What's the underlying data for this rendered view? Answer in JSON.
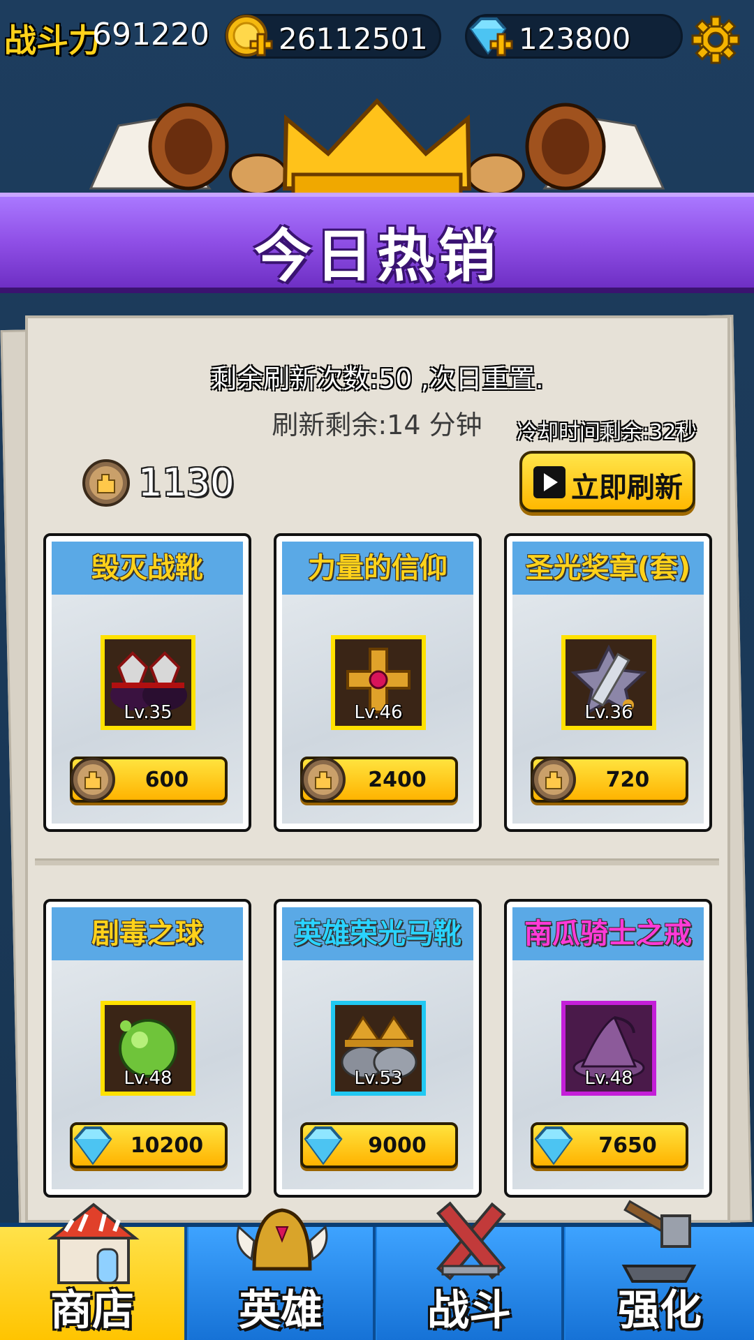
{
  "header": {
    "power_label": "战斗力",
    "power_value": "691220",
    "gold_value": "26112501",
    "gem_value": "123800"
  },
  "banner": {
    "title": "今日热销"
  },
  "shop": {
    "refresh_count_text": "剩余刷新次数:50 ,次日重置.",
    "refresh_remaining_text": "刷新剩余:14 分钟",
    "cooldown_text": "冷却时间剩余:32秒",
    "token_count": "1130",
    "refresh_button_label": "立即刷新",
    "items": [
      {
        "name": "毁灭战靴",
        "level": "Lv.35",
        "price": "600",
        "currency": "token",
        "name_color": "#ffd21a",
        "frame_color": "#ffe100",
        "icon": "boots-icon"
      },
      {
        "name": "力量的信仰",
        "level": "Lv.46",
        "price": "2400",
        "currency": "token",
        "name_color": "#ffd21a",
        "frame_color": "#ffe100",
        "icon": "cross-amulet-icon"
      },
      {
        "name": "圣光奖章(套)",
        "level": "Lv.36",
        "price": "720",
        "currency": "token",
        "name_color": "#ffd21a",
        "frame_color": "#ffe100",
        "icon": "medal-sword-icon"
      },
      {
        "name": "剧毒之球",
        "level": "Lv.48",
        "price": "10200",
        "currency": "gem",
        "name_color": "#ffd21a",
        "frame_color": "#ffe100",
        "icon": "poison-orb-icon"
      },
      {
        "name": "英雄荣光马靴",
        "level": "Lv.53",
        "price": "9000",
        "currency": "gem",
        "name_color": "#2ad3ff",
        "frame_color": "#21c8f2",
        "icon": "armored-boots-icon"
      },
      {
        "name": "南瓜骑士之戒",
        "level": "Lv.48",
        "price": "7650",
        "currency": "gem",
        "name_color": "#ff3ad8",
        "frame_color": "#c41fd8",
        "icon": "wizard-hat-icon"
      }
    ]
  },
  "nav": {
    "tabs": [
      {
        "label": "商店",
        "icon": "shop-icon",
        "active": true
      },
      {
        "label": "英雄",
        "icon": "helmet-icon",
        "active": false
      },
      {
        "label": "战斗",
        "icon": "crossed-swords-icon",
        "active": false
      },
      {
        "label": "强化",
        "icon": "hammer-anvil-icon",
        "active": false
      }
    ]
  },
  "colors": {
    "background": "#1b3a5a",
    "banner_purple": "#8f4fe6",
    "button_yellow": "#ffc400",
    "nav_blue": "#1b7fe0"
  }
}
